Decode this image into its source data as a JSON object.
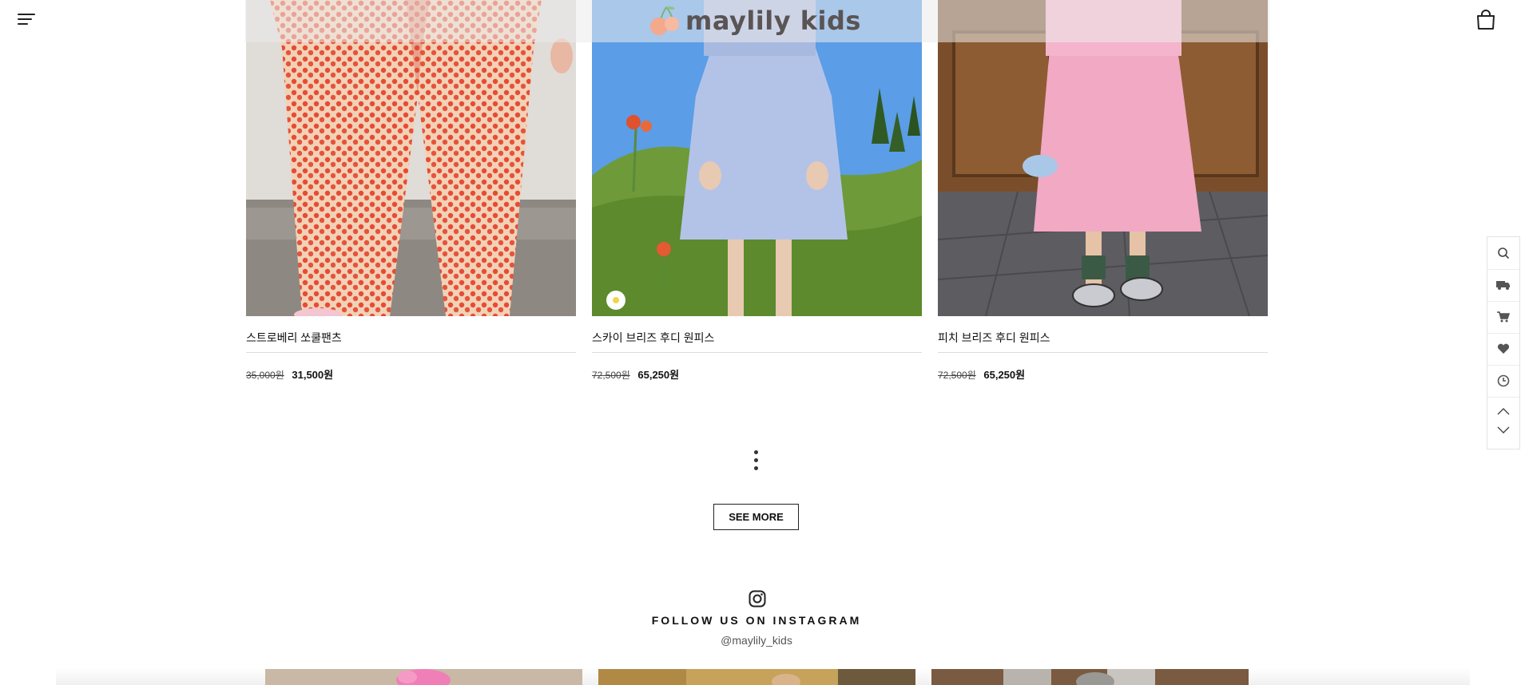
{
  "header": {
    "logo_text": "maylily kids",
    "menu_icon": "hamburger-menu-icon",
    "bag_icon": "shopping-bag-icon"
  },
  "products": [
    {
      "name": "스트로베리 쏘쿨팬츠",
      "old_price": "35,000원",
      "price": "31,500원",
      "image": "child-strawberry-print-pants-photo"
    },
    {
      "name": "스카이 브리즈 후디 원피스",
      "old_price": "72,500원",
      "price": "65,250원",
      "image": "child-blue-hoodie-dress-photo"
    },
    {
      "name": "피치 브리즈 후디 원피스",
      "old_price": "72,500원",
      "price": "65,250원",
      "image": "child-pink-hoodie-dress-photo"
    }
  ],
  "more": {
    "see_more_label": "SEE MORE"
  },
  "instagram": {
    "title": "FOLLOW US ON INSTAGRAM",
    "handle": "@maylily_kids"
  },
  "quickbar": {
    "items": [
      "search-icon",
      "delivery-truck-icon",
      "cart-icon",
      "heart-icon",
      "recent-clock-icon"
    ],
    "arrows": [
      "scroll-up-icon",
      "scroll-down-icon"
    ]
  },
  "colors": {
    "logo_text": "#5a5454",
    "logo_cherry": "#f4a98c",
    "text": "#111111",
    "divider": "#dcdcdc"
  }
}
